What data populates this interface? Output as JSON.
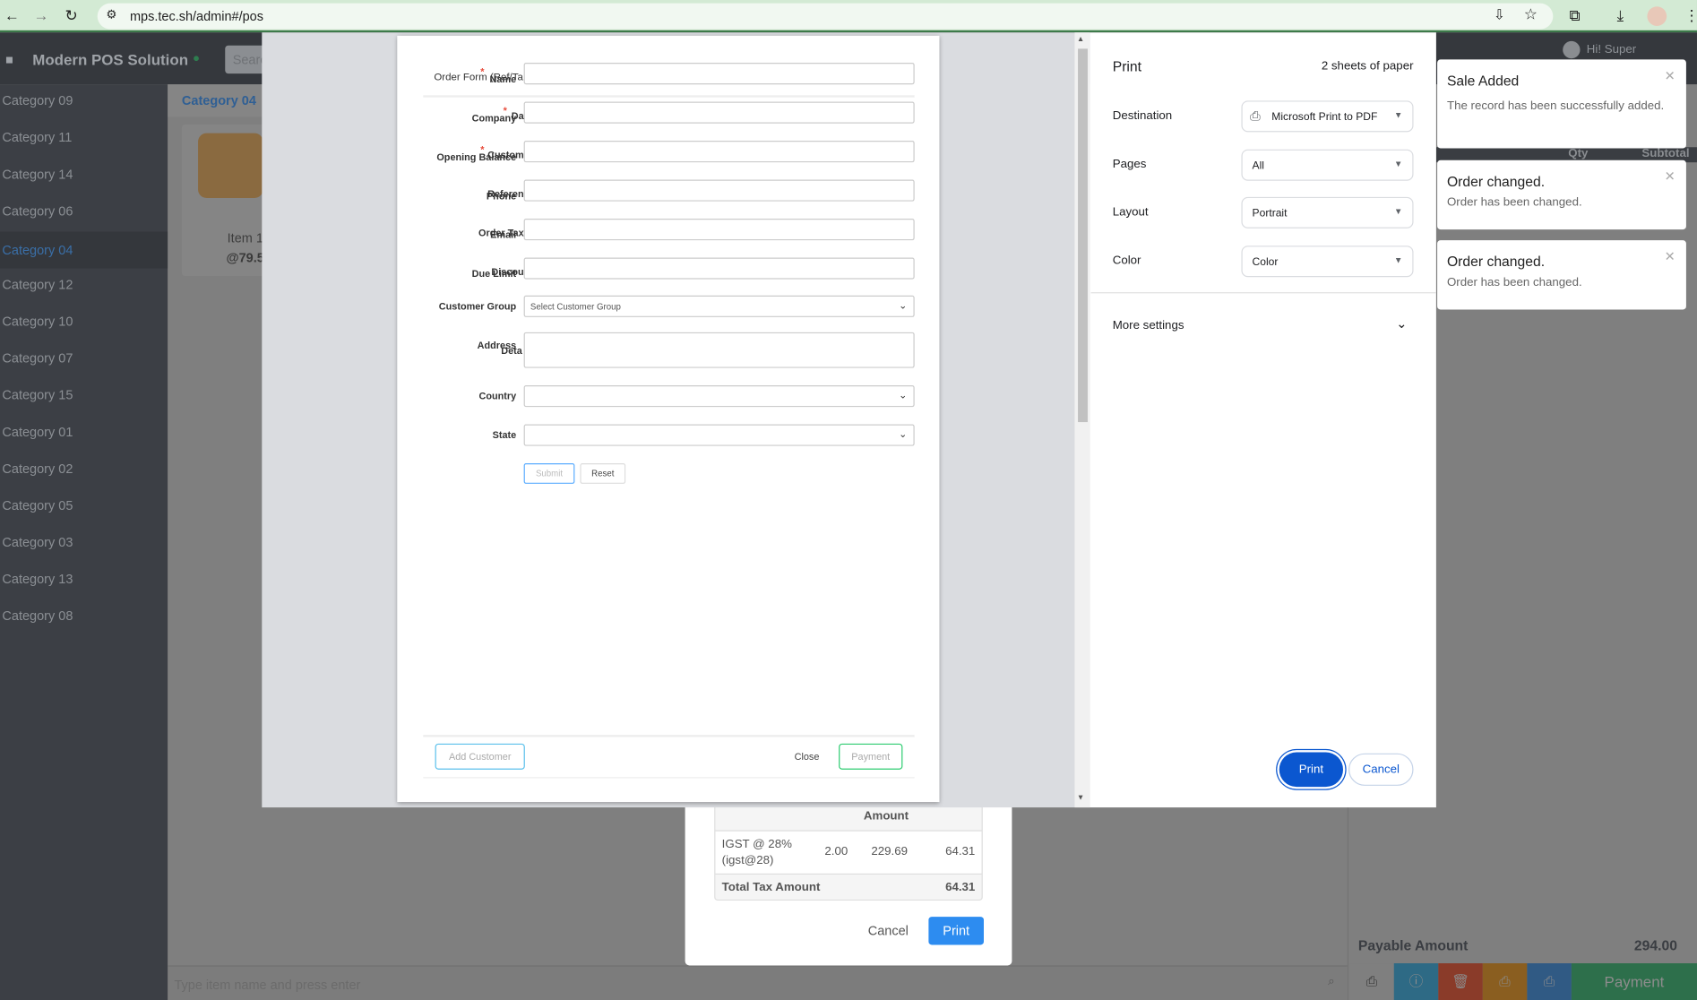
{
  "browser": {
    "url": "mps.tec.sh/admin#/pos"
  },
  "app": {
    "brand": "Modern POS Solution",
    "search_placeholder": "Search",
    "user": "Hi! Super"
  },
  "sidebar": {
    "categories": [
      "Category 09",
      "Category 11",
      "Category 14",
      "Category 06",
      "Category 04",
      "Category 12",
      "Category 10",
      "Category 07",
      "Category 15",
      "Category 01",
      "Category 02",
      "Category 05",
      "Category 03",
      "Category 13",
      "Category 08"
    ],
    "active": "Category 04"
  },
  "main": {
    "category_title": "Category 04",
    "item": {
      "name": "Item 1",
      "price": "@79.5"
    },
    "item_input_placeholder": "Type item name and press enter"
  },
  "cart": {
    "headers": [
      "Qty",
      "Subtotal"
    ],
    "payable_label": "Payable Amount",
    "payable_value": "294.00",
    "payment_label": "Payment"
  },
  "tax_modal": {
    "header": "Amount",
    "row": {
      "name": "IGST @ 28% (igst@28)",
      "rate": "2.00",
      "base": "229.69",
      "amount": "64.31"
    },
    "total_label": "Total Tax Amount",
    "total_value": "64.31",
    "cancel": "Cancel",
    "print": "Print"
  },
  "preview": {
    "order_form_title": "Order Form (Ref/Ta",
    "fields": [
      {
        "label": "Name",
        "required": true,
        "ghost": ""
      },
      {
        "label": "Company",
        "required": false,
        "ghost": "Da"
      },
      {
        "label": "Opening Balance",
        "required": false,
        "ghost": "Custom"
      },
      {
        "label": "Phone",
        "required": false,
        "ghost": "Referen"
      },
      {
        "label": "Email",
        "required": false,
        "ghost": "Order Tax"
      },
      {
        "label": "Due Limit",
        "required": false,
        "ghost": "Discou"
      }
    ],
    "customer_group_label": "Customer Group",
    "customer_group_value": "Select Customer Group",
    "address_label": "Address",
    "address_ghost": "Deta",
    "country_label": "Country",
    "state_label": "State",
    "submit": "Submit",
    "reset": "Reset",
    "add_customer": "Add Customer",
    "close": "Close",
    "payment": "Payment"
  },
  "print_panel": {
    "title": "Print",
    "sheets": "2 sheets of paper",
    "destination_label": "Destination",
    "destination": "Microsoft Print to PDF",
    "pages_label": "Pages",
    "pages": "All",
    "layout_label": "Layout",
    "layout": "Portrait",
    "color_label": "Color",
    "color": "Color",
    "more_settings": "More settings",
    "print": "Print",
    "cancel": "Cancel"
  },
  "toasts": [
    {
      "title": "Sale Added",
      "message": "The record has been successfully added."
    },
    {
      "title": "Order changed.",
      "message": "Order has been changed."
    },
    {
      "title": "Order changed.",
      "message": "Order has been changed."
    }
  ],
  "colors": {
    "print_button": "#0b57d0",
    "primary_blue": "#2d8cf0",
    "payment_green": "#19be6b"
  }
}
